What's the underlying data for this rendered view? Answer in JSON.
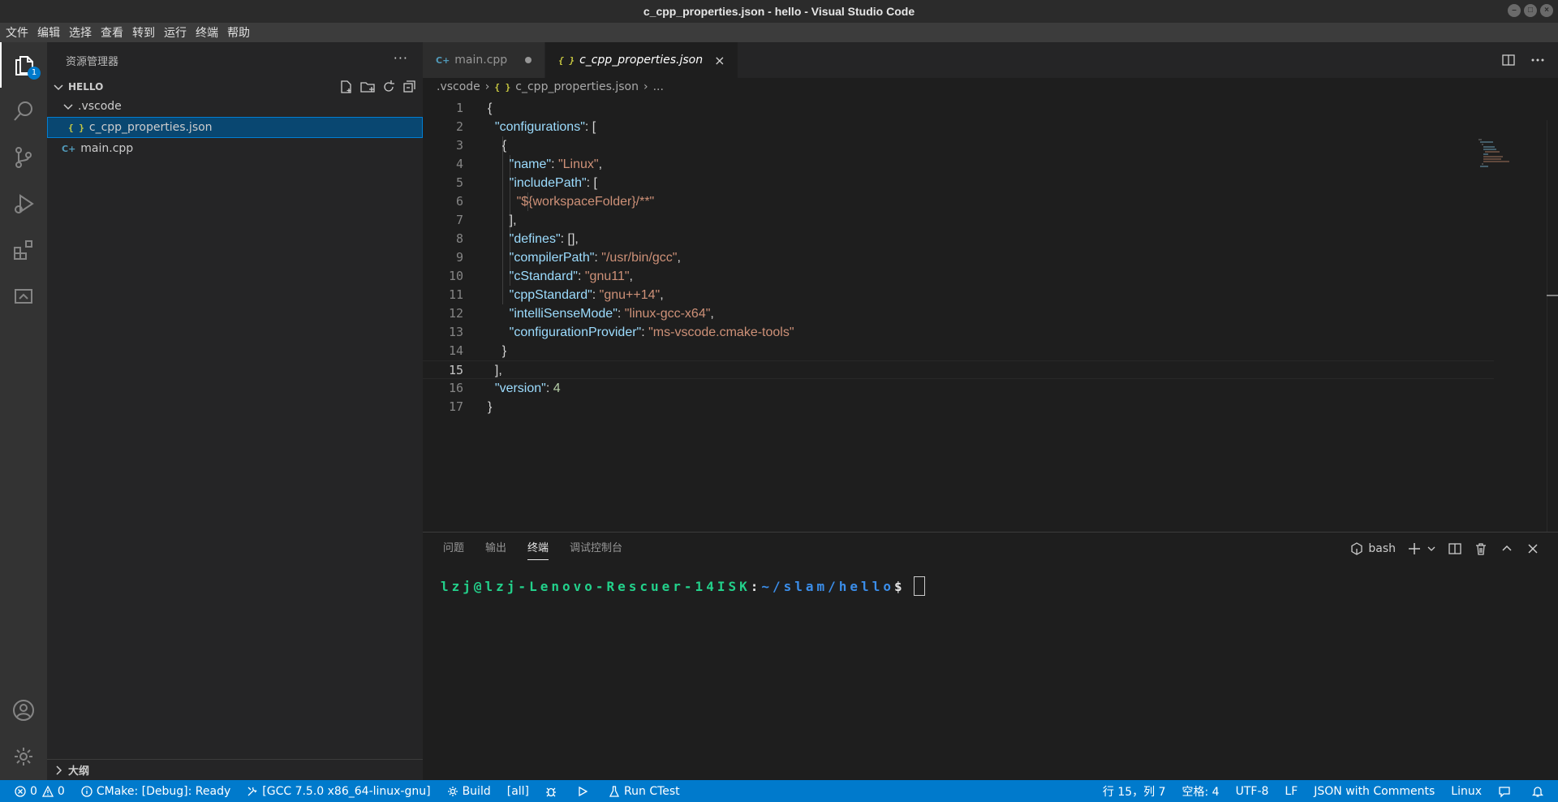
{
  "window": {
    "title": "c_cpp_properties.json - hello - Visual Studio Code"
  },
  "menu": [
    "文件",
    "编辑",
    "选择",
    "查看",
    "转到",
    "运行",
    "终端",
    "帮助"
  ],
  "activity": {
    "explorer_badge": "1"
  },
  "sidebar": {
    "title": "资源管理器",
    "more": "···",
    "folder": "HELLO",
    "tree": [
      {
        "label": ".vscode",
        "type": "folder"
      },
      {
        "label": "c_cpp_properties.json",
        "type": "json"
      },
      {
        "label": "main.cpp",
        "type": "cpp"
      }
    ],
    "outline": "大纲",
    "json_icon": "{ }",
    "cpp_icon": "C+"
  },
  "tabs": [
    {
      "label": "main.cpp",
      "modified": true
    },
    {
      "label": "c_cpp_properties.json",
      "active": true,
      "close": "×"
    }
  ],
  "breadcrumb": [
    ".vscode",
    "c_cpp_properties.json",
    "..."
  ],
  "code": {
    "current_line": 15,
    "lines": [
      "1",
      "2",
      "3",
      "4",
      "5",
      "6",
      "7",
      "8",
      "9",
      "10",
      "11",
      "12",
      "13",
      "14",
      "15",
      "16",
      "17"
    ],
    "keys": {
      "configurations": "\"configurations\"",
      "name": "\"name\"",
      "includePath": "\"includePath\"",
      "defines": "\"defines\"",
      "compilerPath": "\"compilerPath\"",
      "cStandard": "\"cStandard\"",
      "cppStandard": "\"cppStandard\"",
      "intelliSenseMode": "\"intelliSenseMode\"",
      "configurationProvider": "\"configurationProvider\"",
      "version": "\"version\""
    },
    "values": {
      "name": "\"Linux\"",
      "includePath0": "\"${workspaceFolder}/**\"",
      "compilerPath": "\"/usr/bin/gcc\"",
      "cStandard": "\"gnu11\"",
      "cppStandard": "\"gnu++14\"",
      "intelliSenseMode": "\"linux-gcc-x64\"",
      "configurationProvider": "\"ms-vscode.cmake-tools\"",
      "version": "4"
    }
  },
  "panel": {
    "tabs": [
      "问题",
      "输出",
      "终端",
      "调试控制台"
    ],
    "active_tab": "终端",
    "shell": "bash",
    "terminal": {
      "user": "lzj@lzj-Lenovo-Rescuer-14ISK",
      "colon": ":",
      "path": "~/slam/hello",
      "prompt": "$"
    }
  },
  "statusbar": {
    "errors": "0",
    "warnings": "0",
    "cmake": "CMake: [Debug]: Ready",
    "kit": "[GCC 7.5.0 x86_64-linux-gnu]",
    "build": "Build",
    "target": "[all]",
    "ctest": "Run CTest",
    "position": "行 15，列 7",
    "spaces": "空格: 4",
    "encoding": "UTF-8",
    "eol": "LF",
    "language": "JSON with Comments",
    "config": "Linux"
  },
  "colors": {
    "accent": "#007acc",
    "key": "#9cdcfe",
    "string": "#ce9178",
    "number": "#b5cea8",
    "terminal_user": "#23d18b",
    "terminal_path": "#3b8eea"
  }
}
